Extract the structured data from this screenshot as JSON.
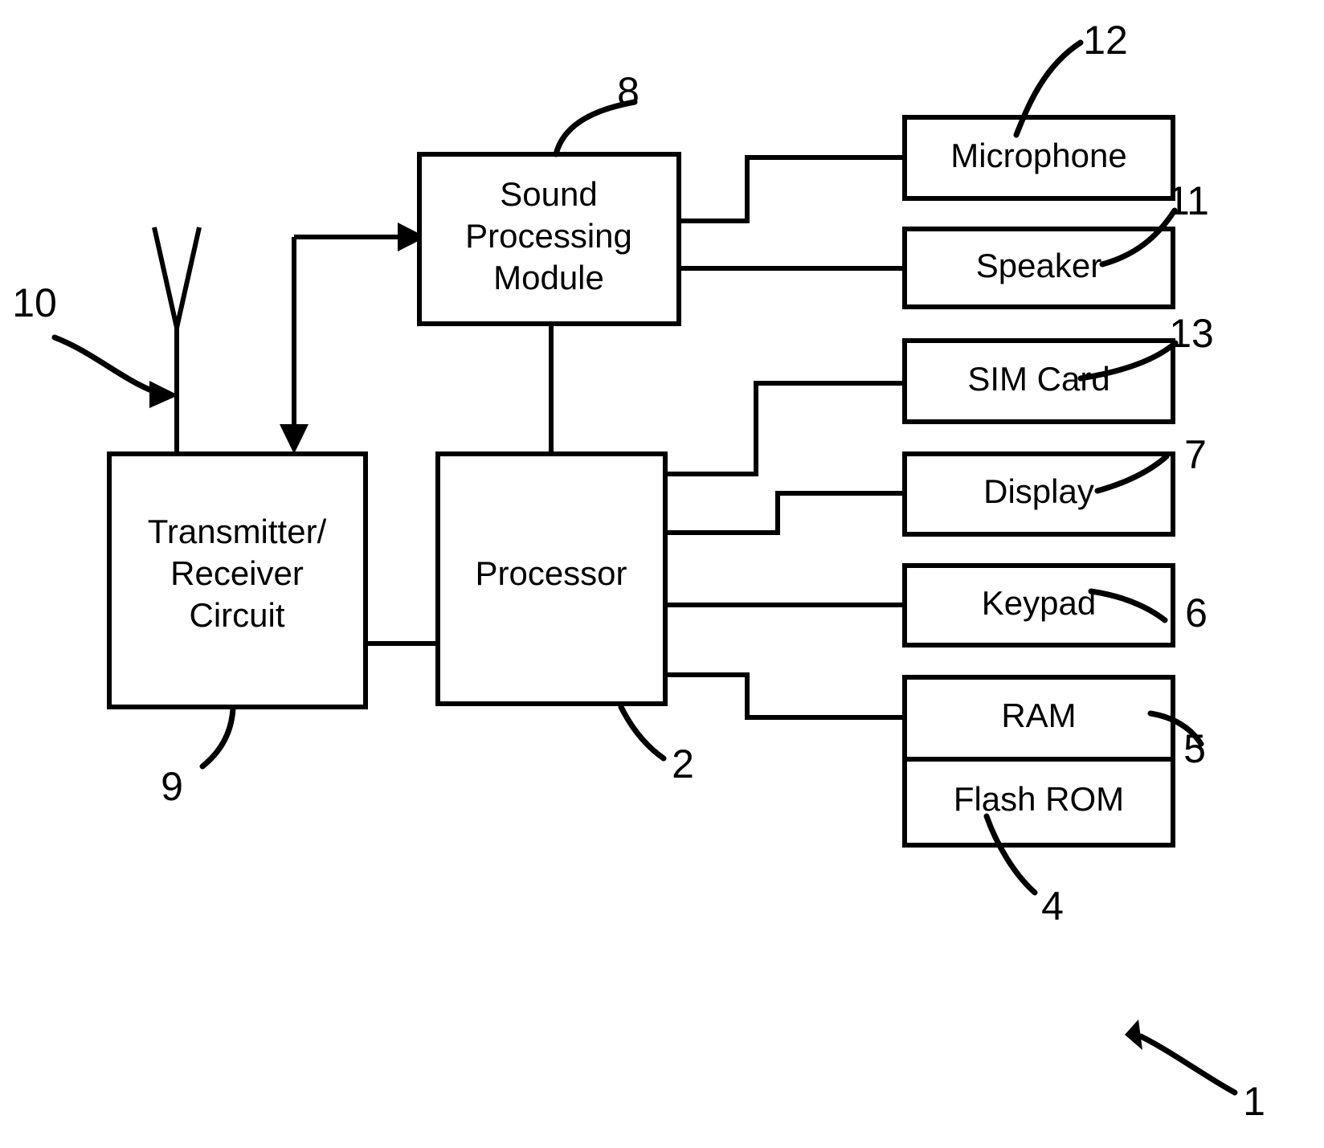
{
  "figure": {
    "type": "patent-block-diagram",
    "title": "Mobile telephone block diagram",
    "background_color": "#ffffff",
    "line_color": "#000000"
  },
  "blocks": [
    {
      "id": "sound_processing_module",
      "label_lines": [
        "Sound",
        "Processing",
        "Module"
      ],
      "ref": "8"
    },
    {
      "id": "transmitter_receiver_circuit",
      "label_lines": [
        "Transmitter/",
        "Receiver",
        "Circuit"
      ],
      "ref": "9"
    },
    {
      "id": "processor",
      "label_lines": [
        "Processor"
      ],
      "ref": "2"
    },
    {
      "id": "microphone",
      "label_lines": [
        "Microphone"
      ],
      "ref": "12"
    },
    {
      "id": "speaker",
      "label_lines": [
        "Speaker"
      ],
      "ref": "11"
    },
    {
      "id": "sim_card",
      "label_lines": [
        "SIM Card"
      ],
      "ref": "13"
    },
    {
      "id": "display",
      "label_lines": [
        "Display"
      ],
      "ref": "7"
    },
    {
      "id": "keypad",
      "label_lines": [
        "Keypad"
      ],
      "ref": "6"
    },
    {
      "id": "ram",
      "label_lines": [
        "RAM"
      ],
      "ref": "5"
    },
    {
      "id": "flash_rom",
      "label_lines": [
        "Flash ROM"
      ],
      "ref": "4"
    }
  ],
  "labels": {
    "sound_line1": "Sound",
    "sound_line2": "Processing",
    "sound_line3": "Module",
    "trx_line1": "Transmitter/",
    "trx_line2": "Receiver",
    "trx_line3": "Circuit",
    "processor": "Processor",
    "microphone": "Microphone",
    "speaker": "Speaker",
    "sim_card": "SIM Card",
    "display": "Display",
    "keypad": "Keypad",
    "ram": "RAM",
    "flash_rom": "Flash ROM"
  },
  "reference_numerals": {
    "antenna": "10",
    "sound_processing_module": "8",
    "microphone": "12",
    "speaker": "11",
    "sim_card": "13",
    "display": "7",
    "keypad": "6",
    "ram": "5",
    "flash_rom": "4",
    "transmitter_receiver_circuit": "9",
    "processor": "2",
    "whole_device": "1"
  },
  "connections": [
    {
      "from": "transmitter_receiver_circuit",
      "to": "sound_processing_module",
      "style": "arrow-into-sound-module"
    },
    {
      "from": "sound_processing_module",
      "to": "transmitter_receiver_circuit",
      "style": "arrow-down-into-trx"
    },
    {
      "from": "sound_processing_module",
      "to": "microphone",
      "style": "stepped"
    },
    {
      "from": "sound_processing_module",
      "to": "speaker",
      "style": "straight"
    },
    {
      "from": "sound_processing_module",
      "to": "processor",
      "style": "vertical"
    },
    {
      "from": "processor",
      "to": "sim_card",
      "style": "stepped"
    },
    {
      "from": "processor",
      "to": "display",
      "style": "stepped"
    },
    {
      "from": "processor",
      "to": "keypad",
      "style": "straight"
    },
    {
      "from": "processor",
      "to": "ram",
      "style": "stepped"
    },
    {
      "from": "processor",
      "to": "transmitter_receiver_circuit",
      "style": "straight"
    }
  ],
  "antenna": {
    "name": "antenna",
    "ref": "10"
  }
}
